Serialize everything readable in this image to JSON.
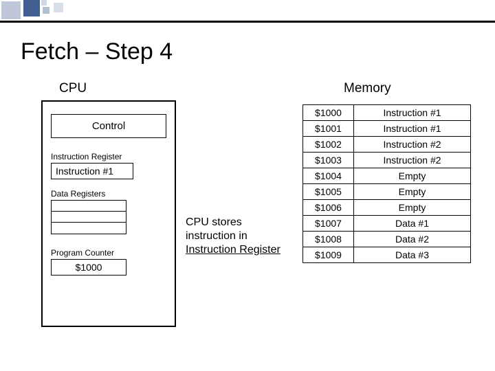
{
  "title": "Fetch – Step 4",
  "cpu": {
    "label": "CPU",
    "control": "Control",
    "ir_label": "Instruction Register",
    "ir_value": "Instruction #1",
    "dreg_label": "Data Registers",
    "pc_label": "Program Counter",
    "pc_value": "$1000"
  },
  "annotation": {
    "line1": "CPU stores",
    "line2": "instruction in",
    "line3": "Instruction Register"
  },
  "memory": {
    "label": "Memory",
    "rows": [
      {
        "addr": "$1000",
        "val": "Instruction #1"
      },
      {
        "addr": "$1001",
        "val": "Instruction #1"
      },
      {
        "addr": "$1002",
        "val": "Instruction #2"
      },
      {
        "addr": "$1003",
        "val": "Instruction #2"
      },
      {
        "addr": "$1004",
        "val": "Empty"
      },
      {
        "addr": "$1005",
        "val": "Empty"
      },
      {
        "addr": "$1006",
        "val": "Empty"
      },
      {
        "addr": "$1007",
        "val": "Data #1"
      },
      {
        "addr": "$1008",
        "val": "Data #2"
      },
      {
        "addr": "$1009",
        "val": "Data #3"
      }
    ]
  }
}
